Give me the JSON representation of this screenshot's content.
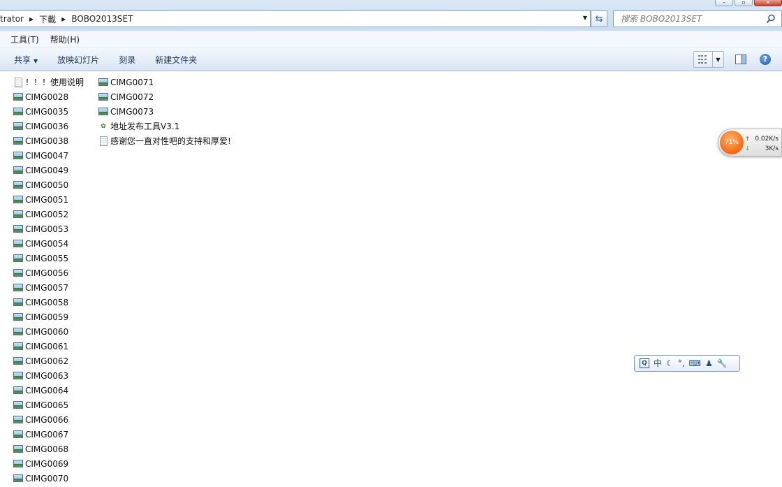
{
  "window": {
    "buttons": [
      "minimize",
      "maximize",
      "close"
    ]
  },
  "address_bar": {
    "crumbs": [
      "trator",
      "下載",
      "BOBO2013SET"
    ]
  },
  "search": {
    "placeholder": "搜索 BOBO2013SET"
  },
  "menu": {
    "items": [
      "工具(T)",
      "帮助(H)"
    ]
  },
  "toolbar": {
    "share_label": "共享",
    "slideshow_label": "放映幻灯片",
    "burn_label": "刻录",
    "new_folder_label": "新建文件夹"
  },
  "files": {
    "column1": [
      {
        "name": "！！！使用说明",
        "icon": "document-icon"
      },
      {
        "name": "CIMG0028",
        "icon": "image-icon"
      },
      {
        "name": "CIMG0035",
        "icon": "image-icon"
      },
      {
        "name": "CIMG0036",
        "icon": "image-icon"
      },
      {
        "name": "CIMG0038",
        "icon": "image-icon"
      },
      {
        "name": "CIMG0047",
        "icon": "image-icon"
      },
      {
        "name": "CIMG0049",
        "icon": "image-icon"
      },
      {
        "name": "CIMG0050",
        "icon": "image-icon"
      },
      {
        "name": "CIMG0051",
        "icon": "image-icon"
      },
      {
        "name": "CIMG0052",
        "icon": "image-icon"
      },
      {
        "name": "CIMG0053",
        "icon": "image-icon"
      },
      {
        "name": "CIMG0054",
        "icon": "image-icon"
      },
      {
        "name": "CIMG0055",
        "icon": "image-icon"
      },
      {
        "name": "CIMG0056",
        "icon": "image-icon"
      },
      {
        "name": "CIMG0057",
        "icon": "image-icon"
      },
      {
        "name": "CIMG0058",
        "icon": "image-icon"
      },
      {
        "name": "CIMG0059",
        "icon": "image-icon"
      },
      {
        "name": "CIMG0060",
        "icon": "image-icon"
      },
      {
        "name": "CIMG0061",
        "icon": "image-icon"
      },
      {
        "name": "CIMG0062",
        "icon": "image-icon"
      },
      {
        "name": "CIMG0063",
        "icon": "image-icon"
      },
      {
        "name": "CIMG0064",
        "icon": "image-icon"
      },
      {
        "name": "CIMG0065",
        "icon": "image-icon"
      },
      {
        "name": "CIMG0066",
        "icon": "image-icon"
      },
      {
        "name": "CIMG0067",
        "icon": "image-icon"
      },
      {
        "name": "CIMG0068",
        "icon": "image-icon"
      },
      {
        "name": "CIMG0069",
        "icon": "image-icon"
      },
      {
        "name": "CIMG0070",
        "icon": "image-icon"
      }
    ],
    "column2": [
      {
        "name": "CIMG0071",
        "icon": "image-icon"
      },
      {
        "name": "CIMG0072",
        "icon": "image-icon"
      },
      {
        "name": "CIMG0073",
        "icon": "image-icon"
      },
      {
        "name": "地址发布工具V3.1",
        "icon": "application-icon"
      },
      {
        "name": "感谢您一直对性吧的支持和厚爱!",
        "icon": "document-icon"
      }
    ]
  },
  "net_monitor": {
    "load_percent": "71%",
    "upload_rate": "0.02K/s",
    "download_rate": "3K/s"
  },
  "ime_toolbar": {
    "mode_label": "中",
    "buttons": [
      "ime-logo-icon",
      "chinese-mode",
      "halfwidth-moon-icon",
      "punctuation-icon",
      "soft-keyboard-icon",
      "user-icon",
      "settings-wrench-icon"
    ]
  }
}
